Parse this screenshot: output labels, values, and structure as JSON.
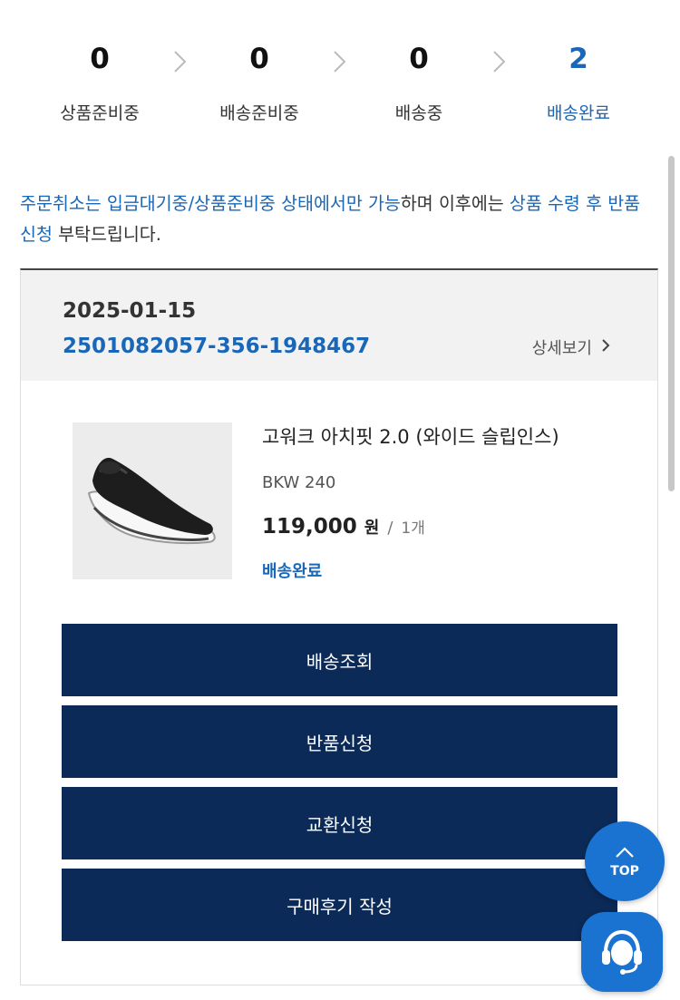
{
  "steps": [
    {
      "count": "0",
      "label": "상품준비중"
    },
    {
      "count": "0",
      "label": "배송준비중"
    },
    {
      "count": "0",
      "label": "배송중"
    },
    {
      "count": "2",
      "label": "배송완료"
    }
  ],
  "notice": {
    "p1": "주문취소는 입금대기중/상품준비중 상태에서만 가능",
    "p2": "하며 이후에는 ",
    "p3": "상품 수령 후 반품 신청",
    "p4": " 부탁드립니다."
  },
  "order": {
    "date": "2025-01-15",
    "number": "2501082057-356-1948467",
    "detail_label": "상세보기"
  },
  "product": {
    "name": "고워크 아치핏 2.0 (와이드 슬립인스)",
    "option": "BKW 240",
    "price": "119,000",
    "currency": "원",
    "separator": "/",
    "quantity": "1개",
    "status": "배송완료"
  },
  "buttons": {
    "tracking": "배송조회",
    "return": "반품신청",
    "exchange": "교환신청",
    "review": "구매후기 작성"
  },
  "floating": {
    "top_label": "TOP"
  },
  "colors": {
    "accent_blue": "#1a67b8",
    "button_navy": "#0b2a57",
    "floating_blue": "#1a72d1"
  },
  "icons": [
    "chevron-right-icon",
    "chevron-up-icon",
    "headset-chat-icon"
  ]
}
